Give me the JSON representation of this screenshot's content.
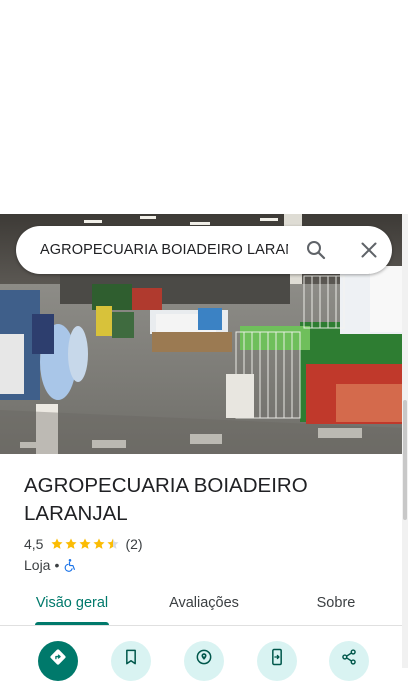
{
  "search": {
    "query": "AGROPECUARIA BOIADEIRO LARAN"
  },
  "place": {
    "name": "AGROPECUARIA BOIADEIRO LARANJAL",
    "rating": "4,5",
    "stars": 4.5,
    "review_count": "(2)",
    "category": "Loja",
    "separator": "•"
  },
  "tabs": [
    {
      "label": "Visão geral",
      "active": true
    },
    {
      "label": "Avaliações",
      "active": false
    },
    {
      "label": "Sobre",
      "active": false
    }
  ],
  "actions": [
    {
      "icon": "directions-icon"
    },
    {
      "icon": "bookmark-icon"
    },
    {
      "icon": "nearby-icon"
    },
    {
      "icon": "send-to-phone-icon"
    },
    {
      "icon": "share-icon"
    }
  ],
  "colors": {
    "accent": "#00796b",
    "action_bg": "#d9f3f2",
    "star": "#fbbc04",
    "accessibility": "#1a73e8"
  }
}
